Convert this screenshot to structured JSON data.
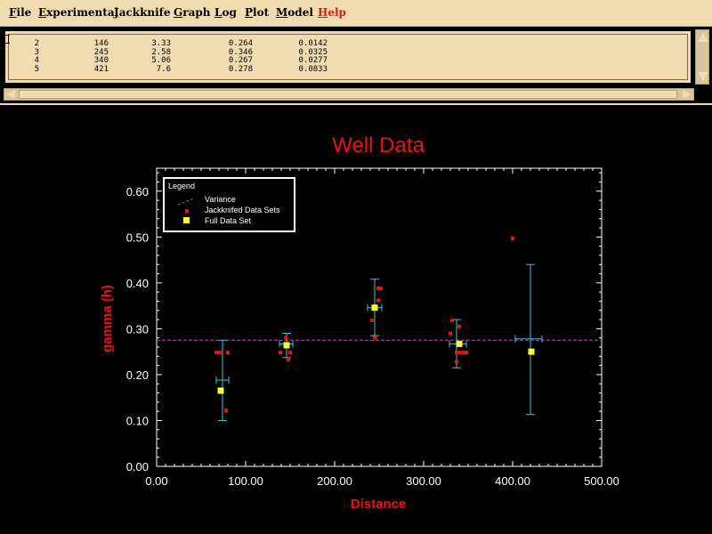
{
  "menubar": {
    "items": [
      {
        "mnemonic": "F",
        "rest": "ile"
      },
      {
        "mnemonic": "E",
        "rest": "xperimental"
      },
      {
        "mnemonic": "J",
        "rest": "ackknife"
      },
      {
        "mnemonic": "G",
        "rest": "raph"
      },
      {
        "mnemonic": "L",
        "rest": "og"
      },
      {
        "mnemonic": "P",
        "rest": "lot"
      },
      {
        "mnemonic": "M",
        "rest": "odel"
      },
      {
        "mnemonic": "H",
        "rest": "elp"
      }
    ]
  },
  "output": {
    "rows": [
      [
        "2",
        "146",
        "3.33",
        "0.264",
        "0.0142"
      ],
      [
        "3",
        "245",
        "2.58",
        "0.346",
        "0.0325"
      ],
      [
        "4",
        "340",
        "5.06",
        "0.267",
        "0.0277"
      ],
      [
        "5",
        "421",
        "7.6",
        "0.278",
        "0.0833"
      ]
    ]
  },
  "colors": {
    "title": "#ee1111",
    "error_bar": "#3fc6d8",
    "jackknife_point": "#ee1111",
    "full_point": "#ffff33",
    "variance_line": "#c33fc3",
    "menu_bg": "#f1dcb1",
    "help_menu": "#d51b1b"
  },
  "chart_data": {
    "type": "scatter",
    "title": "Well Data",
    "xlabel": "Distance",
    "ylabel": "gamma (h)",
    "xlim": [
      0,
      500
    ],
    "ylim": [
      0,
      0.65
    ],
    "x_ticks": [
      "0.00",
      "100.00",
      "200.00",
      "300.00",
      "400.00",
      "500.00"
    ],
    "y_ticks": [
      "0.00",
      "0.10",
      "0.20",
      "0.30",
      "0.40",
      "0.50",
      "0.60"
    ],
    "legend": {
      "title": "Legend",
      "placement": "top-left",
      "entries": [
        "Variance",
        "Jackknifed Data Sets",
        "Full Data Set"
      ]
    },
    "variance": 0.275,
    "full_data_set": [
      {
        "x": 72,
        "y": 0.165
      },
      {
        "x": 146,
        "y": 0.264
      },
      {
        "x": 245,
        "y": 0.346
      },
      {
        "x": 340,
        "y": 0.267
      },
      {
        "x": 421,
        "y": 0.25
      }
    ],
    "error_bars": [
      {
        "x": 74,
        "y": 0.188,
        "y_low": 0.1,
        "y_high": 0.275,
        "x_low": 67,
        "x_high": 81
      },
      {
        "x": 146,
        "y": 0.267,
        "y_low": 0.237,
        "y_high": 0.29,
        "x_low": 138,
        "x_high": 153
      },
      {
        "x": 245,
        "y": 0.346,
        "y_low": 0.285,
        "y_high": 0.408,
        "x_low": 237,
        "x_high": 253
      },
      {
        "x": 337,
        "y": 0.267,
        "y_low": 0.215,
        "y_high": 0.32,
        "x_low": 329,
        "x_high": 348
      },
      {
        "x": 420,
        "y": 0.278,
        "y_low": 0.113,
        "y_high": 0.44,
        "x_low": 403,
        "x_high": 433
      }
    ],
    "jackknifed_data_sets": [
      {
        "x": 67,
        "y": 0.248
      },
      {
        "x": 71,
        "y": 0.248
      },
      {
        "x": 80,
        "y": 0.248
      },
      {
        "x": 78,
        "y": 0.122
      },
      {
        "x": 139,
        "y": 0.248
      },
      {
        "x": 145,
        "y": 0.28
      },
      {
        "x": 148,
        "y": 0.233
      },
      {
        "x": 150,
        "y": 0.248
      },
      {
        "x": 242,
        "y": 0.318
      },
      {
        "x": 245,
        "y": 0.28
      },
      {
        "x": 249,
        "y": 0.362
      },
      {
        "x": 249,
        "y": 0.388
      },
      {
        "x": 252,
        "y": 0.388
      },
      {
        "x": 330,
        "y": 0.29
      },
      {
        "x": 332,
        "y": 0.318
      },
      {
        "x": 337,
        "y": 0.248
      },
      {
        "x": 341,
        "y": 0.248
      },
      {
        "x": 340,
        "y": 0.305
      },
      {
        "x": 344,
        "y": 0.248
      },
      {
        "x": 348,
        "y": 0.248
      },
      {
        "x": 337,
        "y": 0.228
      },
      {
        "x": 400,
        "y": 0.497
      }
    ]
  }
}
